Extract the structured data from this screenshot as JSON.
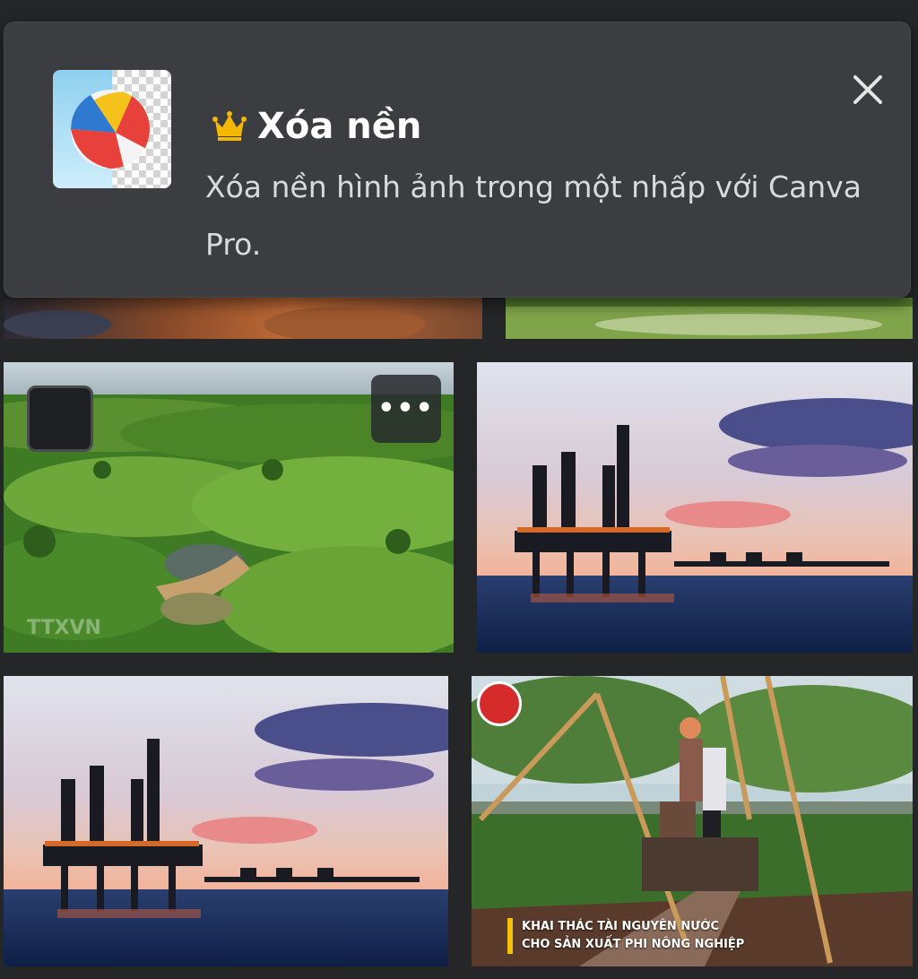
{
  "promo": {
    "title": "Xóa nền",
    "description": "Xóa nền hình ảnh trong một nhấp với Canva Pro.",
    "title_icon": "crown-icon",
    "close_icon": "close-icon",
    "accent_color": "#f5b800"
  },
  "results": {
    "more_label": "•••",
    "tile1_watermark": "TTXVN",
    "tile4_caption_line1": "KHAI THÁC TÀI NGUYÊN NƯỚC",
    "tile4_caption_line2": "CHO SẢN XUẤT PHI NÔNG NGHIỆP"
  }
}
